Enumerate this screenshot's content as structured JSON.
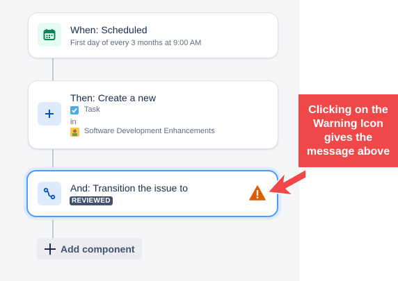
{
  "trigger": {
    "title": "When: Scheduled",
    "subtitle": "First day of every 3 months at 9:00 AM"
  },
  "action_create": {
    "title": "Then: Create a new",
    "issue_type": "Task",
    "in_label": "in",
    "project": "Software Development Enhancements"
  },
  "action_transition": {
    "title": "And: Transition the issue to",
    "status": "REVIEWED"
  },
  "add_component": {
    "label": "Add component"
  },
  "annotation": {
    "text": "Clicking on the Warning Icon gives the message above"
  },
  "colors": {
    "warning": "#de5c00",
    "callout": "#f04848",
    "selected_border": "#4c9aff"
  }
}
